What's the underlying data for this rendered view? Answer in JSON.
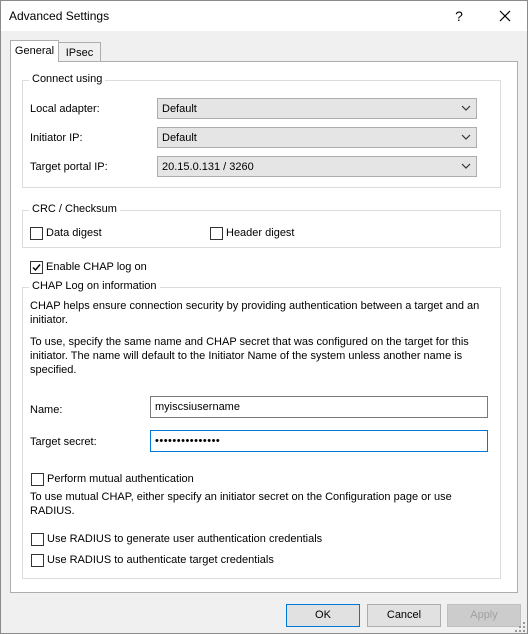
{
  "window": {
    "title": "Advanced Settings",
    "help_glyph": "?",
    "close_glyph": "✕"
  },
  "tabs": [
    {
      "label": "General",
      "selected": true
    },
    {
      "label": "IPsec",
      "selected": false
    }
  ],
  "connect_using": {
    "title": "Connect using",
    "local_adapter": {
      "label": "Local adapter:",
      "value": "Default"
    },
    "initiator_ip": {
      "label": "Initiator IP:",
      "value": "Default"
    },
    "target_portal_ip": {
      "label": "Target portal IP:",
      "value": "20.15.0.131 / 3260"
    }
  },
  "crc": {
    "title": "CRC / Checksum",
    "data_digest": {
      "label": "Data digest",
      "checked": false
    },
    "header_digest": {
      "label": "Header digest",
      "checked": false
    }
  },
  "chap": {
    "enable_label": "Enable CHAP log on",
    "enable_checked": true,
    "group_title": "CHAP Log on information",
    "description1": "CHAP helps ensure connection security by providing authentication between a target and an initiator.",
    "description2": "To use, specify the same name and CHAP secret that was configured on the target for this initiator.  The name will default to the Initiator Name of the system unless another name is specified.",
    "name_label": "Name:",
    "name_value": "myiscsiusername",
    "secret_label": "Target secret:",
    "secret_value": "•••••••••••••••",
    "mutual_label": "Perform mutual authentication",
    "mutual_checked": false,
    "mutual_description": "To use mutual CHAP, either specify an initiator secret on the Configuration page or use RADIUS.",
    "radius_generate_label": "Use RADIUS to generate user authentication credentials",
    "radius_generate_checked": false,
    "radius_target_label": "Use RADIUS to authenticate target credentials",
    "radius_target_checked": false
  },
  "buttons": {
    "ok": "OK",
    "cancel": "Cancel",
    "apply": "Apply"
  },
  "colors": {
    "accent": "#0078d7",
    "disabled_text": "#a0a0a0"
  }
}
